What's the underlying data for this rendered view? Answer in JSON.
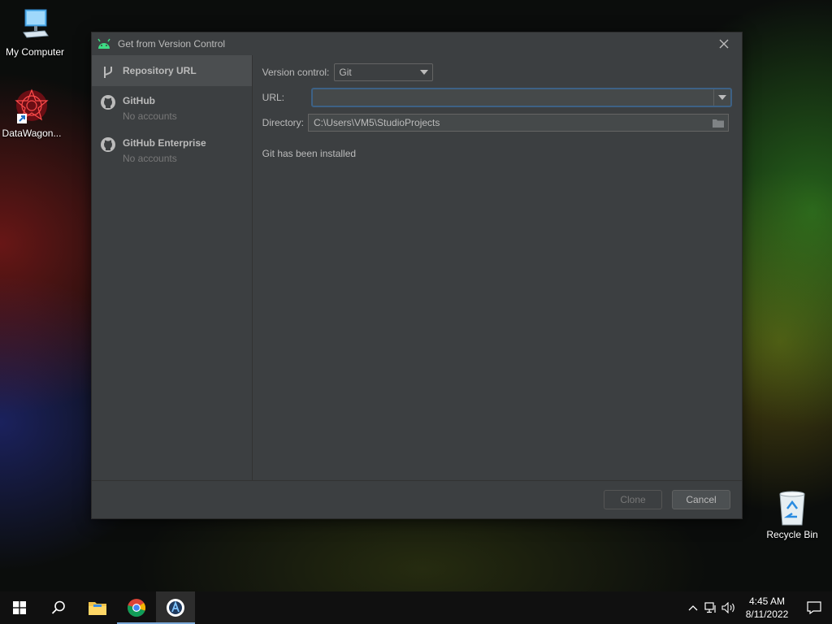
{
  "desktop": {
    "icons": [
      {
        "label": "My Computer"
      },
      {
        "label": "DataWagon..."
      },
      {
        "label": "Recycle Bin"
      }
    ]
  },
  "dialog": {
    "title": "Get from Version Control",
    "sidebar": {
      "items": [
        {
          "name": "Repository URL",
          "sub": ""
        },
        {
          "name": "GitHub",
          "sub": "No accounts"
        },
        {
          "name": "GitHub Enterprise",
          "sub": "No accounts"
        }
      ]
    },
    "form": {
      "vcs_label": "Version control:",
      "vcs_value": "Git",
      "url_label": "URL:",
      "url_value": "",
      "dir_label": "Directory:",
      "dir_value": "C:\\Users\\VM5\\StudioProjects",
      "status": "Git has been installed"
    },
    "buttons": {
      "clone": "Clone",
      "cancel": "Cancel"
    }
  },
  "taskbar": {
    "time": "4:45 AM",
    "date": "8/11/2022"
  },
  "colors": {
    "accent": "#3d6185",
    "dialog_bg": "#3c3f41",
    "selected_bg": "#4b4e50"
  }
}
